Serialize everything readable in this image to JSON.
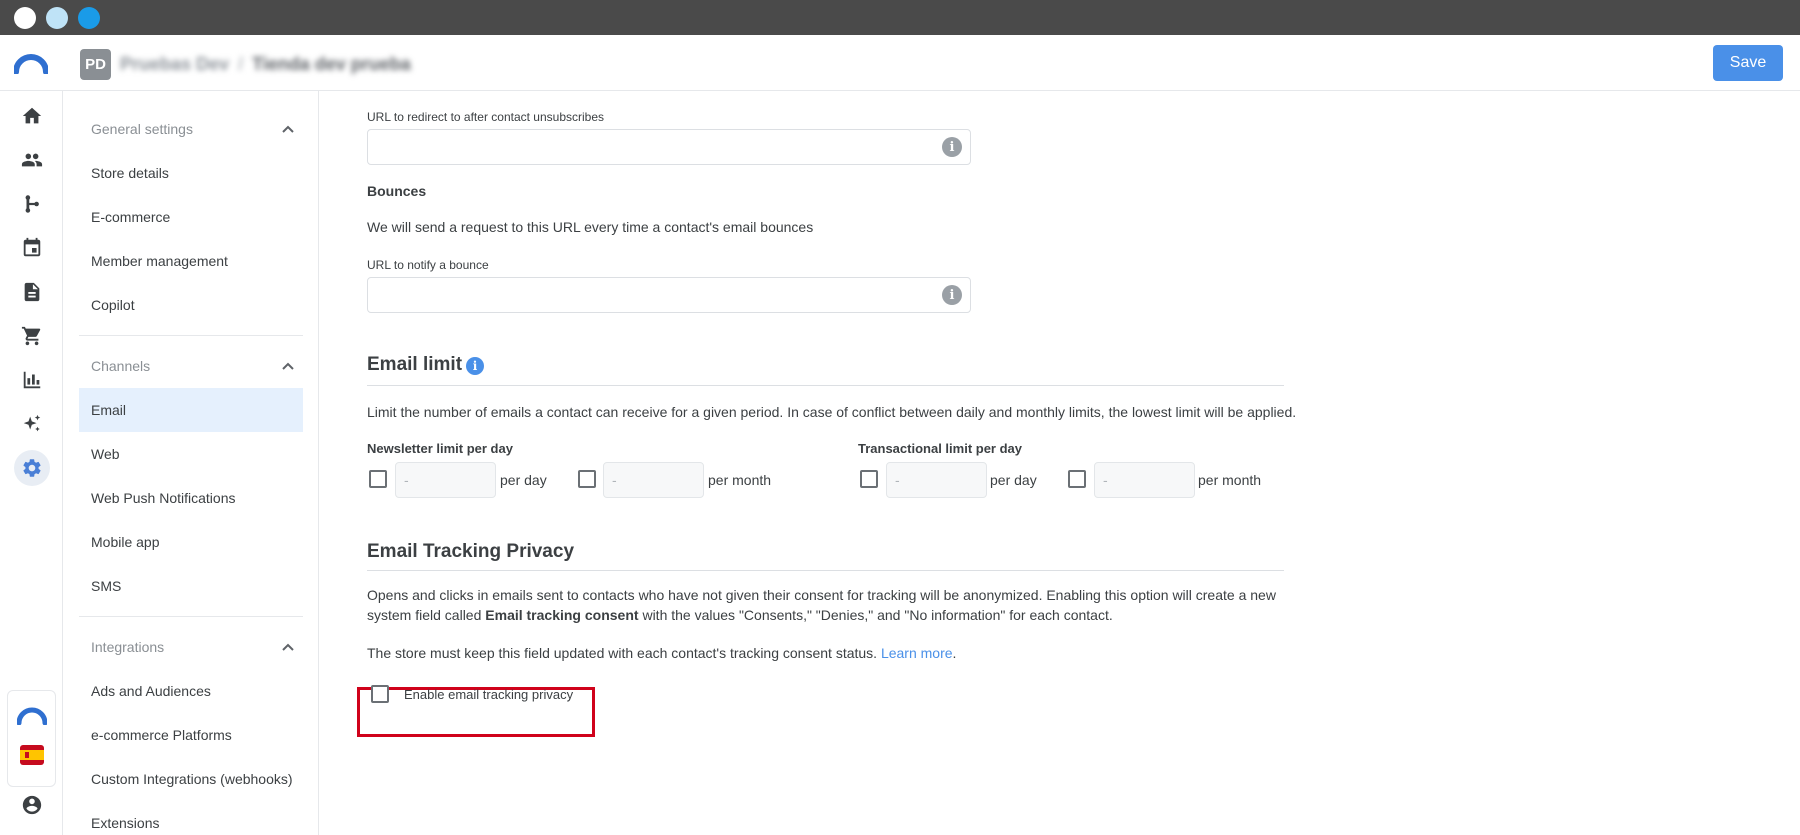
{
  "header": {
    "workspace_badge": "PD",
    "account_name": "Pruebas Dev",
    "separator": "/",
    "store_name": "Tienda dev prueba",
    "save_label": "Save"
  },
  "rail": {
    "icons": [
      "home-icon",
      "contacts-icon",
      "automation-icon",
      "calendar-icon",
      "document-icon",
      "cart-icon",
      "analytics-icon",
      "sparkles-icon",
      "settings-icon"
    ],
    "bottom_icons": [
      "brand-logo-icon",
      "spain-flag-icon"
    ],
    "account_icon": "account-circle-icon"
  },
  "sidebar": {
    "sections": [
      {
        "title": "General settings",
        "items": [
          "Store details",
          "E-commerce",
          "Member management",
          "Copilot"
        ]
      },
      {
        "title": "Channels",
        "items": [
          "Email",
          "Web",
          "Web Push Notifications",
          "Mobile app",
          "SMS"
        ]
      },
      {
        "title": "Integrations",
        "items": [
          "Ads and Audiences",
          "e-commerce Platforms",
          "Custom Integrations (webhooks)",
          "Extensions"
        ]
      }
    ],
    "active_item": "Email"
  },
  "main": {
    "unsubscribe_url_label": "URL to redirect to after contact unsubscribes",
    "unsubscribe_url_value": "",
    "bounces_title": "Bounces",
    "bounces_desc": "We will send a request to this URL every time a contact's email bounces",
    "bounce_url_label": "URL to notify a bounce",
    "bounce_url_value": "",
    "email_limit": {
      "title": "Email limit",
      "desc": "Limit the number of emails a contact can receive for a given period. In case of conflict between daily and monthly limits, the lowest limit will be applied.",
      "newsletter_label": "Newsletter limit per day",
      "transactional_label": "Transactional limit per day",
      "placeholder": "-",
      "per_day": "per day",
      "per_month": "per month"
    },
    "tracking": {
      "title": "Email Tracking Privacy",
      "desc_before": "Opens and clicks in emails sent to contacts who have not given their consent for tracking will be anonymized. Enabling this option will create a new system field called ",
      "desc_bold": "Email tracking consent",
      "desc_after": " with the values \"Consents,\" \"Denies,\" and \"No information\" for each contact.",
      "note": "The store must keep this field updated with each contact's tracking consent status. ",
      "learn_more": "Learn more",
      "note_end": ".",
      "checkbox_label": "Enable email tracking privacy"
    }
  },
  "colors": {
    "accent": "#4a90e8",
    "active_bg": "#e5f0fd",
    "highlight": "#d0021b",
    "os_bar": "#4a4a4a"
  }
}
